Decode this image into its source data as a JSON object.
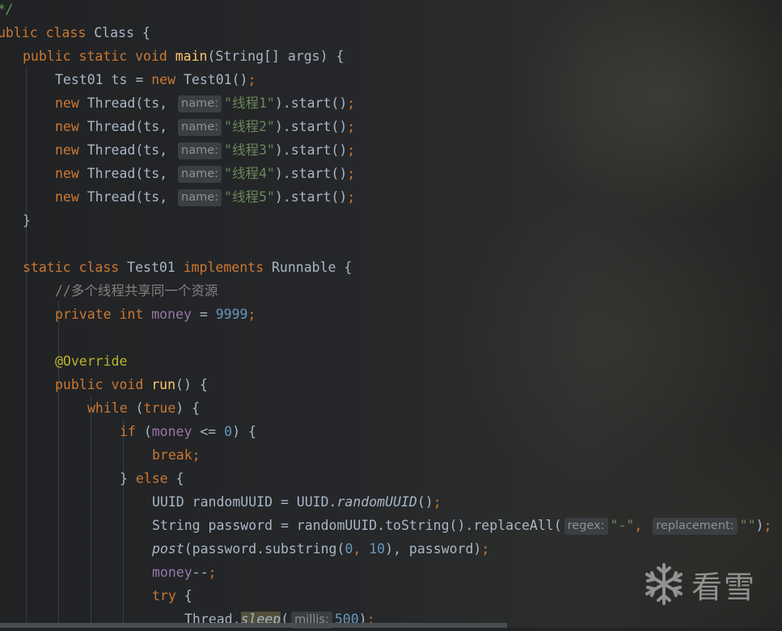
{
  "watermark": {
    "text": "看雪",
    "icon": "snowflake-icon"
  },
  "code": {
    "l1_doc": "*/",
    "l2_kw": "ublic class ",
    "l2_rest": "Class {",
    "l3_kw": "public static void ",
    "l3_fn": "main",
    "l3_rest": "(String[] args) {",
    "l4_a": "Test01 ts = ",
    "l4_kw": "new ",
    "l4_b": "Test01()",
    "l4_semi": ";",
    "thread_new": "new ",
    "thread_a": "Thread(ts,",
    "hint_name": "name:",
    "thread_strs": [
      "\"线程1\"",
      "\"线程2\"",
      "\"线程3\"",
      "\"线程4\"",
      "\"线程5\""
    ],
    "thread_tail": ").start()",
    "semi": ";",
    "brace_close": "}",
    "l11_kw1": "static class ",
    "l11_a": "Test01 ",
    "l11_kw2": "implements ",
    "l11_b": "Runnable {",
    "l12_cmt": "//多个线程共享同一个资源",
    "l13_kw": "private int ",
    "l13_fld": "money",
    "l13_eq": " = ",
    "l13_num": "9999",
    "l15_ann": "@Override",
    "l16_kw": "public void ",
    "l16_fn": "run",
    "l16_rest": "() {",
    "l17_kw": "while ",
    "l17_a": "(",
    "l17_kw2": "true",
    "l17_b": ") {",
    "l18_kw": "if ",
    "l18_a": "(",
    "l18_fld": "money",
    "l18_op": " <= ",
    "l18_num": "0",
    "l18_b": ") {",
    "l19_kw": "break",
    "l20_a": "} ",
    "l20_kw": "else ",
    "l20_b": "{",
    "l21_a": "UUID randomUUID = UUID.",
    "l21_st": "randomUUID",
    "l21_b": "()",
    "l22_a": "String password = randomUUID.toString().replaceAll(",
    "hint_regex": "regex:",
    "l22_s1": "\"-\"",
    "comma": ",",
    "hint_replacement": "replacement:",
    "l22_s2": "\"\"",
    "l22_b": ")",
    "l23_st": "post",
    "l23_a": "(password.substring(",
    "l23_n1": "0",
    "l23_n2": "10",
    "l23_b": "), password)",
    "l24_fld": "money",
    "l24_op": "--",
    "l25_kw": "try ",
    "l25_b": "{",
    "l26_a": "Thread.",
    "l26_st": "sleep",
    "l26_p": "(",
    "hint_millis": "millis:",
    "l26_num": "500",
    "l26_b": ")"
  }
}
